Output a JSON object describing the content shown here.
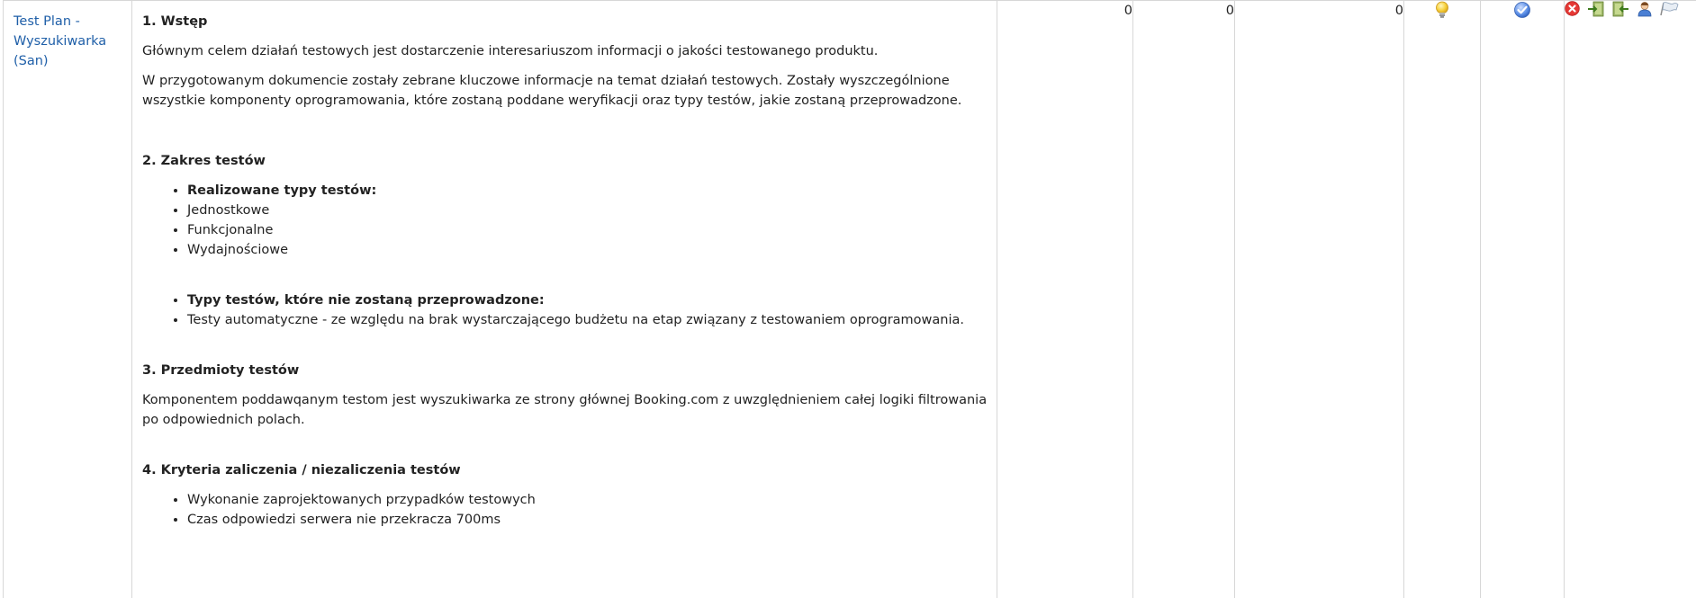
{
  "row": {
    "plan_name": "Test Plan - Wyszukiwarka (San)",
    "description": {
      "section1": {
        "heading": "1. Wstęp",
        "p1": "Głównym celem działań testowych jest dostarczenie interesariuszom informacji o jakości testowanego produktu.",
        "p2": "W przygotowanym dokumencie zostały zebrane kluczowe informacje na temat działań testowych. Zostały wyszczególnione wszystkie komponenty oprogramowania, które zostaną poddane weryfikacji oraz typy testów, jakie zostaną przeprowadzone."
      },
      "section2": {
        "heading": "2. Zakres testów",
        "realized_label": "Realizowane typy testów:",
        "realized_items": [
          "Jednostkowe",
          "Funkcjonalne",
          "Wydajnościowe"
        ],
        "not_realized_label": "Typy testów, które nie zostaną przeprowadzone:",
        "not_realized_items": [
          "Testy automatyczne - ze względu na brak wystarczającego budżetu na etap związany z testowaniem oprogramowania."
        ]
      },
      "section3": {
        "heading": "3. Przedmioty testów",
        "p1": "Komponentem poddawqanym testom jest wyszukiwarka ze strony głównej Booking.com z uwzględnieniem całej logiki filtrowania po odpowiednich polach."
      },
      "section4": {
        "heading": "4. Kryteria zaliczenia / niezaliczenia testów",
        "items": [
          "Wykonanie zaprojektowanych przypadków testowych",
          "Czas odpowiedzi serwera nie przekracza 700ms"
        ]
      }
    },
    "count_1": "0",
    "count_2": "0",
    "count_3": "0",
    "active_icon": "lightbulb-icon",
    "public_icon": "check-circle-icon",
    "actions": [
      "delete-icon",
      "export-icon",
      "import-icon",
      "assign-user-icon",
      "execute-icon"
    ]
  },
  "colors": {
    "link": "#1f5fa8",
    "border": "#d7d7d7",
    "delete_red": "#e53935",
    "check_blue": "#5b8ee6",
    "bulb_yellow": "#f7d23e"
  }
}
